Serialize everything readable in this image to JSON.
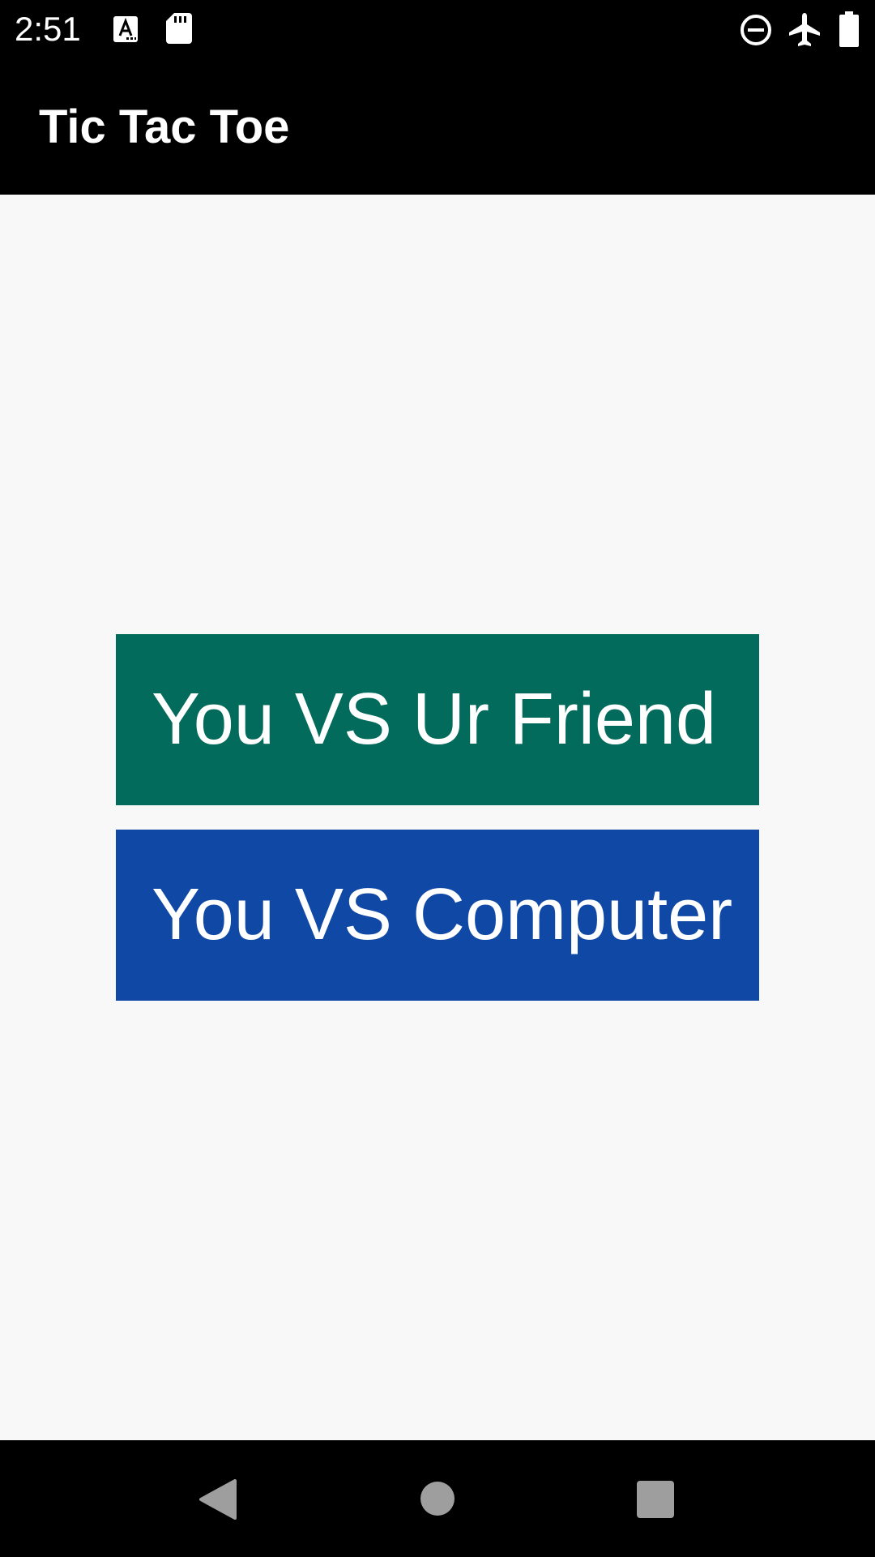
{
  "status_bar": {
    "time": "2:51",
    "left_icons": [
      "keyboard-a-icon",
      "sd-card-icon"
    ],
    "right_icons": [
      "do-not-disturb-icon",
      "airplane-mode-icon",
      "battery-icon"
    ]
  },
  "app_bar": {
    "title": "Tic Tac Toe"
  },
  "menu": {
    "vs_friend_label": "You VS Ur Friend",
    "vs_computer_label": "You VS Computer"
  },
  "nav_bar": {
    "icons": [
      "back-icon",
      "home-icon",
      "recents-icon"
    ]
  },
  "colors": {
    "vs_friend_bg": "#036b5b",
    "vs_computer_bg": "#1048a6",
    "background": "#f8f8f8",
    "bars": "#000000"
  }
}
